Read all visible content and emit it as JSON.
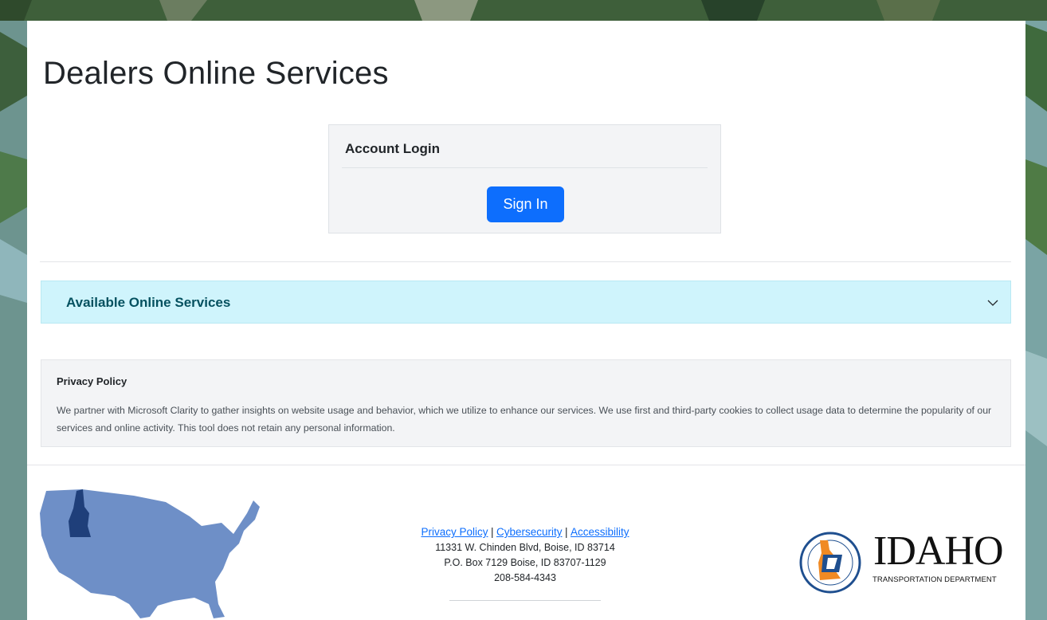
{
  "page": {
    "title": "Dealers Online Services"
  },
  "login": {
    "card_title": "Account Login",
    "signin_label": "Sign In"
  },
  "services": {
    "accordion_label": "Available Online Services",
    "expand_icon": "chevron-down-icon"
  },
  "privacy": {
    "title": "Privacy Policy",
    "text": "We partner with Microsoft Clarity to gather insights on website usage and behavior, which we utilize to enhance our services. We use first and third-party cookies to collect usage data to determine the popularity of our services and online activity. This tool does not retain any personal information."
  },
  "footer": {
    "links": [
      "Privacy Policy",
      "Cybersecurity",
      "Accessibility"
    ],
    "separator": "|",
    "address_line1": "11331 W. Chinden Blvd, Boise, ID 83714",
    "address_line2": "P.O. Box 7129 Boise, ID 83707-1129",
    "phone": "208-584-4343",
    "logo_word": "IDAHO",
    "logo_subtitle": "TRANSPORTATION DEPARTMENT",
    "seal_text": "IDAHO TRANSPORTATION DEPARTMENT"
  },
  "colors": {
    "primary_button": "#0d6efd",
    "accordion_bg": "#cff4fc",
    "accordion_text": "#055160",
    "map_fill": "#6e8fc7",
    "idaho_highlight": "#1f3f7a",
    "seal_orange": "#f08a24"
  }
}
